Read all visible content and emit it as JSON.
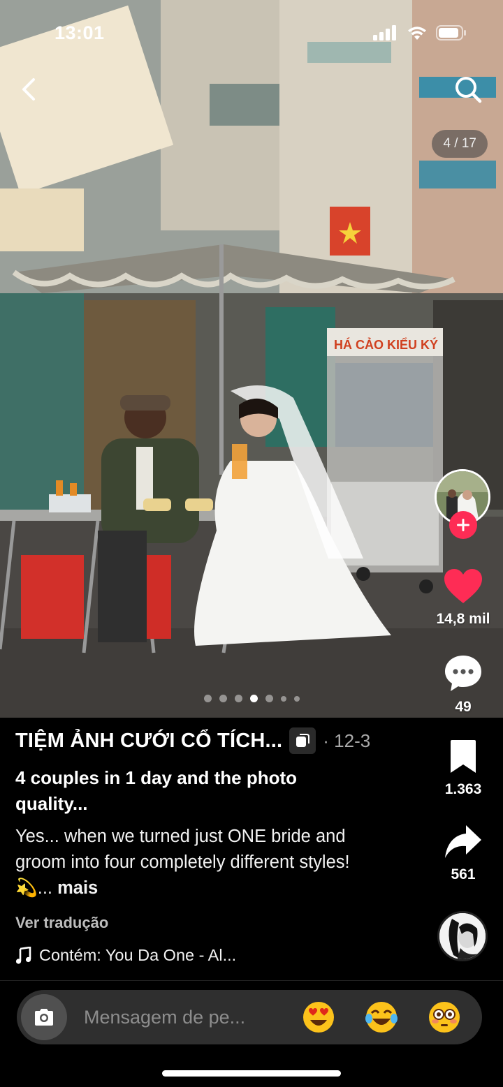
{
  "status_bar": {
    "time": "13:01",
    "icons": [
      "cellular-signal-icon",
      "wifi-icon",
      "battery-icon"
    ]
  },
  "photo": {
    "counter": "4 / 17",
    "storefront_sign": "KIỂU KÝ",
    "cart_sign": "HÁ CẢO KIỂU KÝ",
    "carousel_dots": 7,
    "active_dot": 3
  },
  "actions": {
    "likes": "14,8 mil",
    "comments": "49",
    "saves": "1.363",
    "shares": "561",
    "like_color": "#fe2c55"
  },
  "caption": {
    "author": "TIỆM ẢNH CƯỚI CỔ TÍCH...",
    "date": "· 12-3",
    "title": "4 couples in 1 day and the photo quality...",
    "description": "Yes... when we turned just ONE bride and groom into four completely different styles! 💫...",
    "more": "mais",
    "translate": "Ver tradução",
    "music": "Contém: You Da One - Al..."
  },
  "message_bar": {
    "placeholder": "Mensagem de pe...",
    "emoji_1": "😍",
    "emoji_2": "😂",
    "emoji_3": "😳"
  }
}
